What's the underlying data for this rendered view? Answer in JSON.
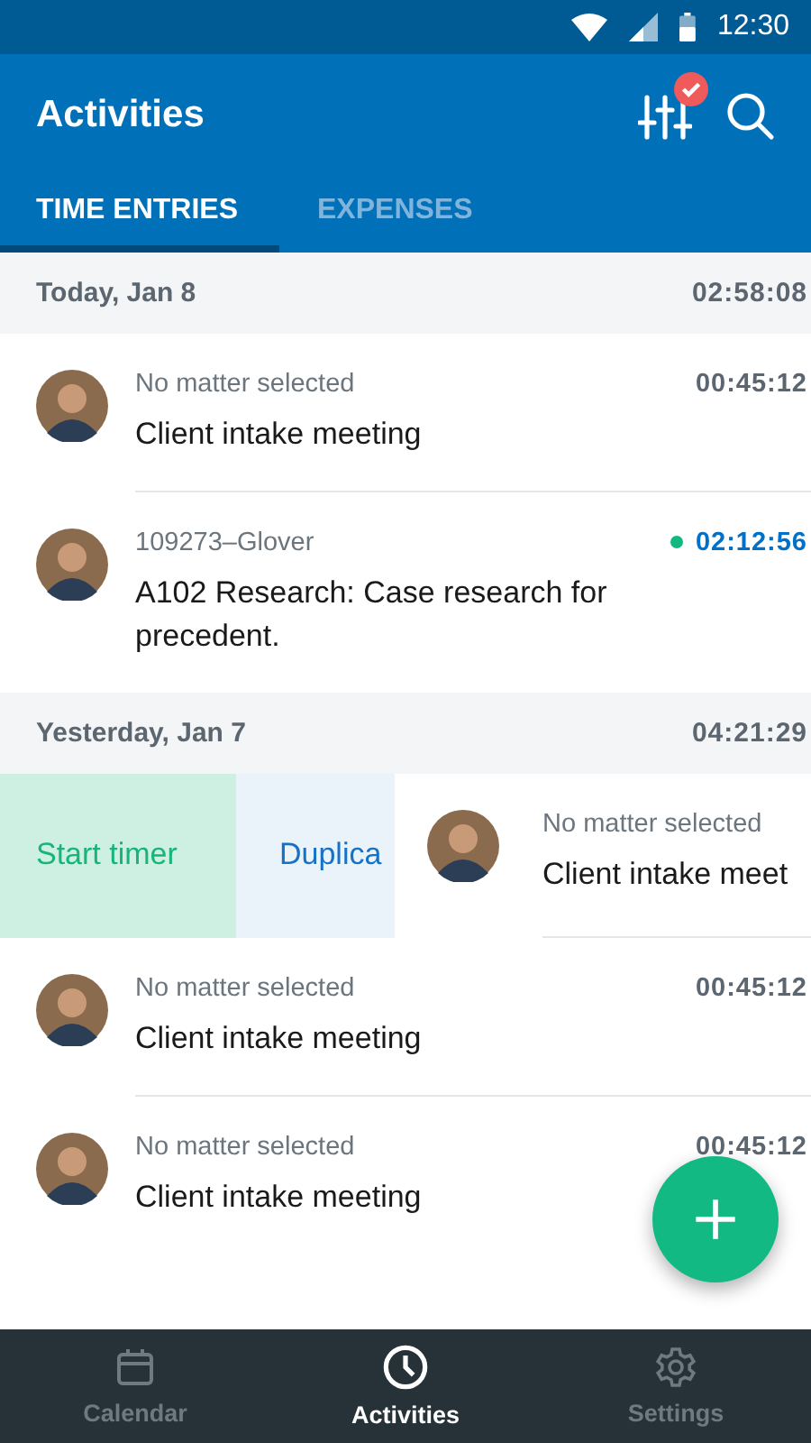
{
  "status_bar": {
    "time": "12:30"
  },
  "app_bar": {
    "title": "Activities",
    "filter_active": true
  },
  "tabs": [
    {
      "label": "TIME ENTRIES",
      "selected": true
    },
    {
      "label": "EXPENSES",
      "selected": false
    }
  ],
  "groups": [
    {
      "date": "Today, Jan 8",
      "total": "02:58:08",
      "entries": [
        {
          "kind": "entry",
          "matter": "No matter selected",
          "time": "00:45:12",
          "description": "Client intake meeting",
          "running": false
        },
        {
          "kind": "entry",
          "matter": "109273–Glover",
          "time": "02:12:56",
          "description": "A102 Research: Case research for precedent.",
          "running": true
        }
      ]
    },
    {
      "date": "Yesterday, Jan 7",
      "total": "04:21:29",
      "entries": [
        {
          "kind": "swiped",
          "actions": [
            {
              "label": "Start timer",
              "kind": "start"
            },
            {
              "label": "Duplica",
              "kind": "duplicate"
            }
          ],
          "matter": "No matter selected",
          "description": "Client intake meet"
        },
        {
          "kind": "entry",
          "matter": "No matter selected",
          "time": "00:45:12",
          "description": "Client intake meeting",
          "running": false
        },
        {
          "kind": "entry",
          "matter": "No matter selected",
          "time": "00:45:12",
          "description": "Client intake meeting",
          "running": false
        }
      ]
    }
  ],
  "nav": [
    {
      "label": "Calendar",
      "kind": "calendar",
      "selected": false
    },
    {
      "label": "Activities",
      "kind": "activities",
      "selected": true
    },
    {
      "label": "Settings",
      "kind": "settings",
      "selected": false
    }
  ]
}
